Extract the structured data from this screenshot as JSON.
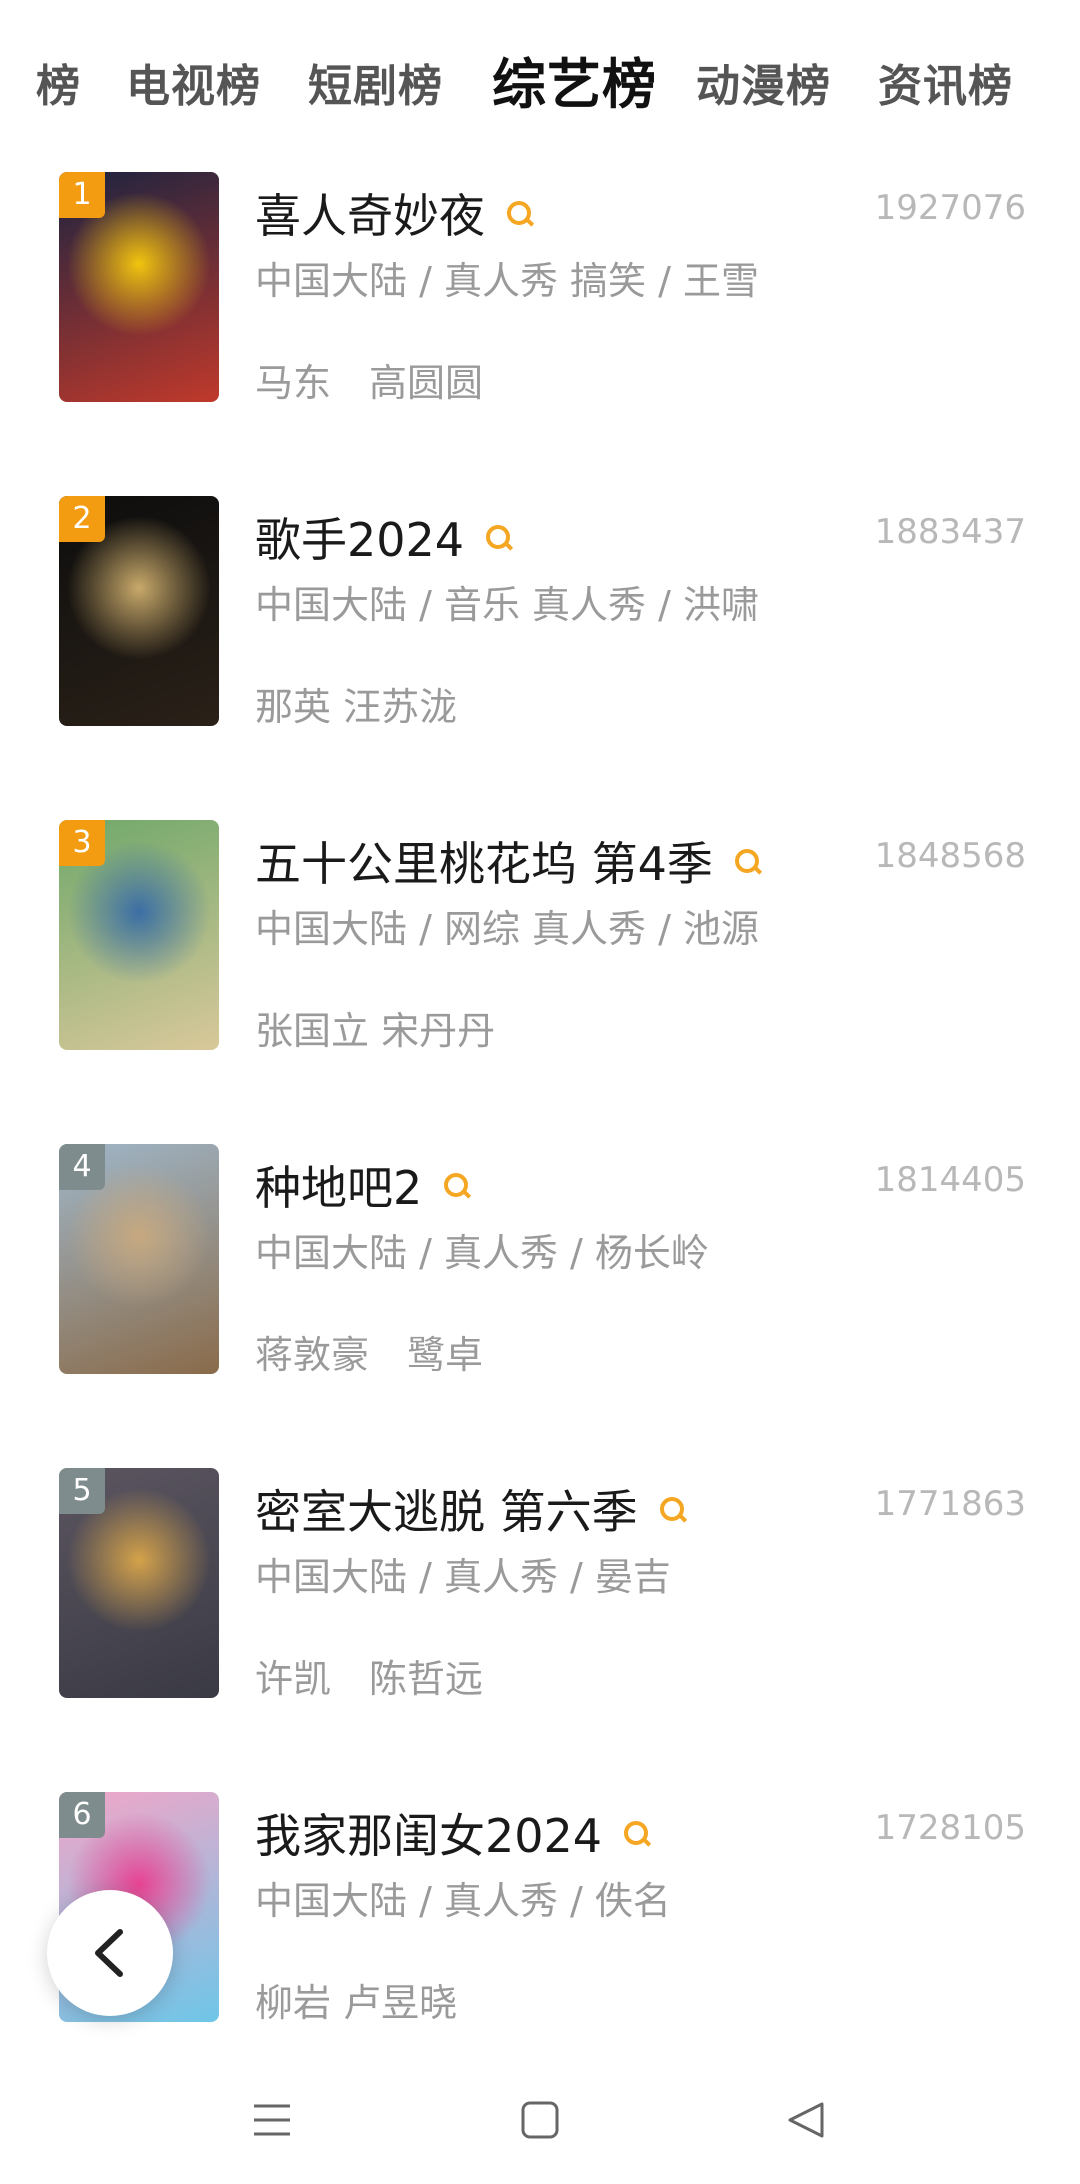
{
  "tabs": [
    {
      "label": "榜",
      "active": false
    },
    {
      "label": "电视榜",
      "active": false
    },
    {
      "label": "短剧榜",
      "active": false
    },
    {
      "label": "综艺榜",
      "active": true
    },
    {
      "label": "动漫榜",
      "active": false
    },
    {
      "label": "资讯榜",
      "active": false
    }
  ],
  "items": [
    {
      "rank": "1",
      "title": "喜人奇妙夜",
      "score": "1927076",
      "meta": "中国大陆 / 真人秀 搞笑 / 王雪",
      "cast": "马东　高圆圆",
      "rank_color": "#f39c12",
      "poster_colors": [
        "#1b2340",
        "#c0392b",
        "#f1c40f"
      ]
    },
    {
      "rank": "2",
      "title": "歌手2024",
      "score": "1883437",
      "meta": "中国大陆 / 音乐 真人秀 / 洪啸",
      "cast": "那英 汪苏泷",
      "rank_color": "#f39c12",
      "poster_colors": [
        "#0d0d0d",
        "#2a2118",
        "#c8a96a"
      ]
    },
    {
      "rank": "3",
      "title": "五十公里桃花坞 第4季",
      "score": "1848568",
      "meta": "中国大陆 / 网综 真人秀 / 池源",
      "cast": "张国立 宋丹丹",
      "rank_color": "#f39c12",
      "poster_colors": [
        "#6fa86a",
        "#d9c89a",
        "#3b6ea5"
      ]
    },
    {
      "rank": "4",
      "title": "种地吧2",
      "score": "1814405",
      "meta": "中国大陆 / 真人秀 / 杨长岭",
      "cast": "蒋敦豪　鹭卓",
      "rank_color": "#7f8c8d",
      "poster_colors": [
        "#9fb6c8",
        "#8a6b4a",
        "#c7a980"
      ]
    },
    {
      "rank": "5",
      "title": "密室大逃脱 第六季",
      "score": "1771863",
      "meta": "中国大陆 / 真人秀 /  晏吉",
      "cast": "许凯　陈哲远",
      "rank_color": "#7f8c8d",
      "poster_colors": [
        "#5b5560",
        "#3a3a44",
        "#d4a24a"
      ]
    },
    {
      "rank": "6",
      "title": "我家那闺女2024",
      "score": "1728105",
      "meta": "中国大陆 / 真人秀 / 佚名",
      "cast": "柳岩 卢昱晓",
      "rank_color": "#7f8c8d",
      "poster_colors": [
        "#f2a6c8",
        "#6ec6e8",
        "#e84393"
      ]
    }
  ],
  "icons": {
    "search": "search-icon",
    "back": "chevron-left-icon",
    "nav_menu": "menu-icon",
    "nav_home": "home-square-icon",
    "nav_back": "back-triangle-icon"
  },
  "colors": {
    "accent": "#f5a623",
    "rank_top": "#f39c12",
    "rank_other": "#7f8c8d"
  }
}
